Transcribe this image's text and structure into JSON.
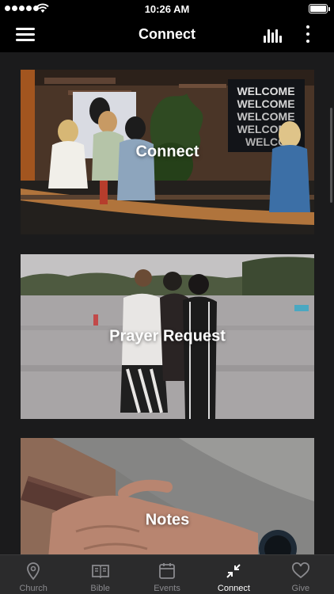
{
  "status_bar": {
    "time": "10:26 AM"
  },
  "header": {
    "title": "Connect",
    "menu_icon": "hamburger-menu-icon",
    "chart_icon": "bar-chart-icon",
    "more_icon": "vertical-ellipsis-icon"
  },
  "cards": [
    {
      "label": "Connect",
      "image": "welcome-desk-photo"
    },
    {
      "label": "Prayer Request",
      "image": "women-hugging-by-lake-photo"
    },
    {
      "label": "Notes",
      "image": "hands-holding-phone-photo"
    }
  ],
  "tabs": [
    {
      "label": "Church",
      "icon": "location-pin-icon"
    },
    {
      "label": "Bible",
      "icon": "open-book-icon"
    },
    {
      "label": "Events",
      "icon": "calendar-icon"
    },
    {
      "label": "Connect",
      "icon": "compress-arrows-icon"
    },
    {
      "label": "Give",
      "icon": "heart-icon"
    }
  ],
  "colors": {
    "background": "#1b1b1c",
    "header": "#000000",
    "tabbar": "#2b2b2c",
    "tab_inactive": "#8a8a8e",
    "tab_active": "#ffffff"
  },
  "active_tab": "Connect"
}
